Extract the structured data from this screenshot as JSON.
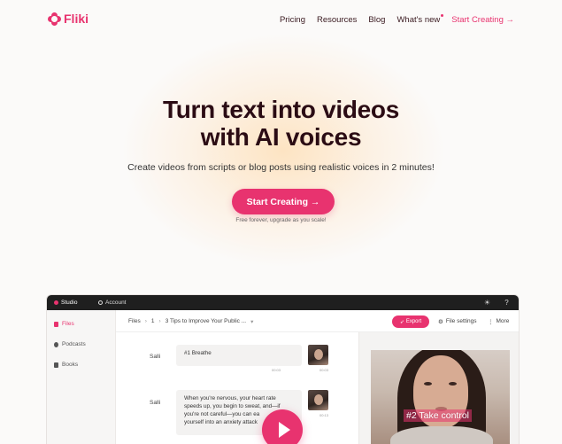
{
  "brand": {
    "name": "Fliki",
    "accent": "#e8336f"
  },
  "nav": {
    "links": [
      "Pricing",
      "Resources",
      "Blog",
      "What's new"
    ],
    "cta": "Start Creating →"
  },
  "hero": {
    "title_line1": "Turn text into videos",
    "title_line2": "with AI voices",
    "subtitle": "Create videos from scripts or blog posts using realistic voices in 2 minutes!",
    "button": "Start Creating →",
    "note": "Free forever, upgrade as you scale!"
  },
  "app": {
    "tabs": {
      "studio": "Studio",
      "account": "Account"
    },
    "sidebar": [
      {
        "label": "Files",
        "icon": "file-icon"
      },
      {
        "label": "Podcasts",
        "icon": "podcast-icon"
      },
      {
        "label": "Books",
        "icon": "book-icon"
      }
    ],
    "breadcrumb": {
      "root": "Files",
      "folder": "1",
      "file": "3 Tips to Improve Your Public ..."
    },
    "toolbar": {
      "export": "Export",
      "file_settings": "File settings",
      "more": "More"
    },
    "scenes": [
      {
        "speaker": "Salli",
        "text": "#1 Breathe",
        "timecode": "00:03",
        "timecode_left": "00:03"
      },
      {
        "speaker": "Salli",
        "text_lines": [
          "When you're nervous, your heart rate",
          "speeds up, you begin to sweat, and—if",
          "you're not careful—you can ea",
          "yourself into an anxiety attack"
        ],
        "timecode": "00:13"
      }
    ],
    "preview": {
      "caption": "#2 Take control"
    }
  }
}
